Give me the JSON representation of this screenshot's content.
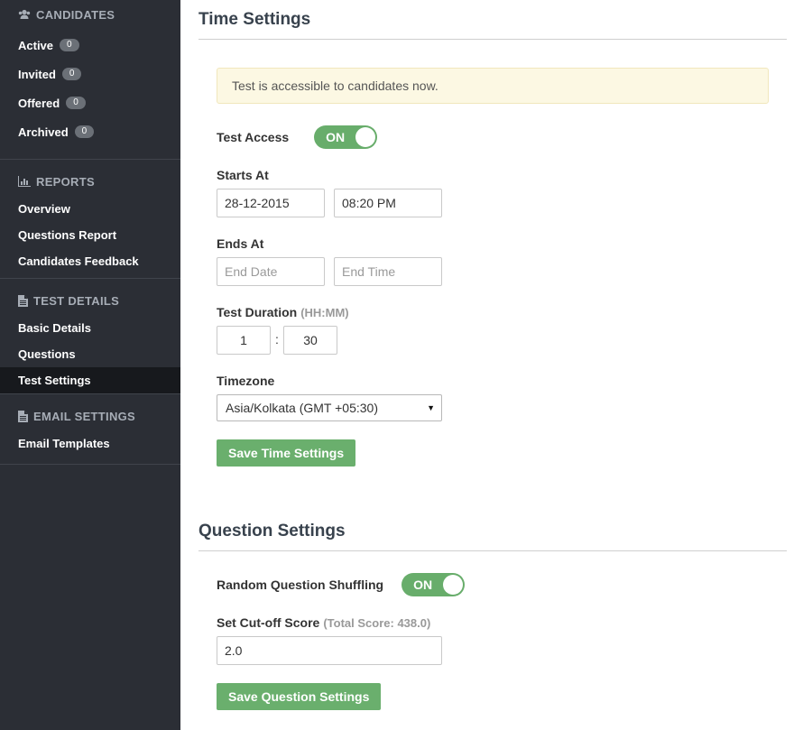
{
  "sidebar": {
    "candidates": {
      "heading": "CANDIDATES",
      "items": [
        {
          "label": "Active",
          "count": "0"
        },
        {
          "label": "Invited",
          "count": "0"
        },
        {
          "label": "Offered",
          "count": "0"
        },
        {
          "label": "Archived",
          "count": "0"
        }
      ]
    },
    "reports": {
      "heading": "REPORTS",
      "items": [
        {
          "label": "Overview"
        },
        {
          "label": "Questions Report"
        },
        {
          "label": "Candidates Feedback"
        }
      ]
    },
    "test_details": {
      "heading": "TEST DETAILS",
      "items": [
        {
          "label": "Basic Details"
        },
        {
          "label": "Questions"
        },
        {
          "label": "Test Settings"
        }
      ],
      "active": "Test Settings"
    },
    "email_settings": {
      "heading": "EMAIL SETTINGS",
      "items": [
        {
          "label": "Email Templates"
        }
      ]
    }
  },
  "time_settings": {
    "title": "Time Settings",
    "alert": "Test is accessible to candidates now.",
    "test_access_label": "Test Access",
    "test_access_toggle": "ON",
    "starts_at_label": "Starts At",
    "start_date": "28-12-2015",
    "start_time": "08:20 PM",
    "ends_at_label": "Ends At",
    "end_date_placeholder": "End Date",
    "end_time_placeholder": "End Time",
    "duration_label": "Test Duration",
    "duration_hint": "(HH:MM)",
    "duration_hours": "1",
    "duration_sep": ":",
    "duration_minutes": "30",
    "timezone_label": "Timezone",
    "timezone_value": "Asia/Kolkata (GMT +05:30)",
    "save_label": "Save Time Settings"
  },
  "question_settings": {
    "title": "Question Settings",
    "shuffle_label": "Random Question Shuffling",
    "shuffle_toggle": "ON",
    "cutoff_label": "Set Cut-off Score",
    "cutoff_hint": "(Total Score: 438.0)",
    "cutoff_value": "2.0",
    "save_label": "Save Question Settings"
  },
  "colors": {
    "sidebar_bg": "#2b2e35",
    "sidebar_active": "#17191d",
    "accent_green": "#6aaf6d",
    "alert_bg": "#fcf8e3"
  }
}
